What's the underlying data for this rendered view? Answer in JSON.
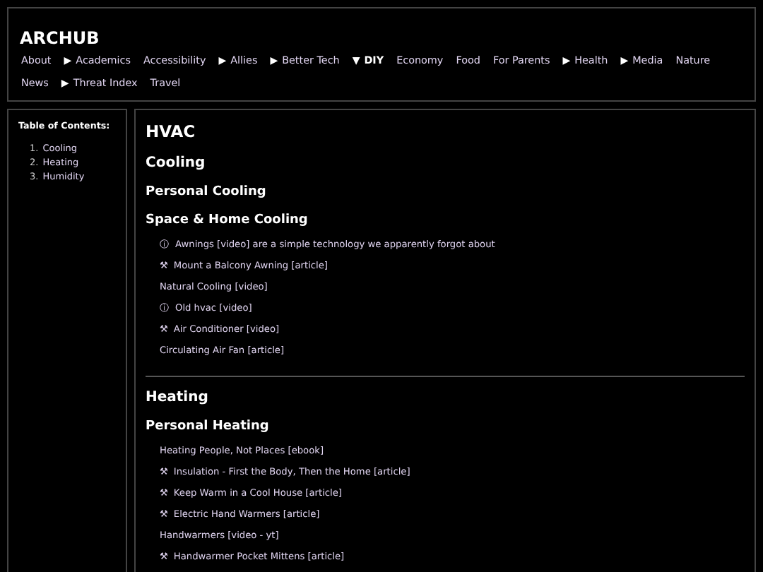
{
  "site": {
    "title": "ARCHUB"
  },
  "nav": [
    {
      "label": "About",
      "selected": false
    },
    {
      "label": "Academics",
      "marker": "▶",
      "selected": false
    },
    {
      "label": "Accessibility",
      "selected": false
    },
    {
      "label": "Allies",
      "marker": "▶",
      "selected": false
    },
    {
      "label": "Better Tech",
      "marker": "▶",
      "selected": false
    },
    {
      "label": "DIY",
      "marker": "▼",
      "selected": true
    },
    {
      "label": "Economy",
      "selected": false
    },
    {
      "label": "Food",
      "selected": false
    },
    {
      "label": "For Parents",
      "selected": false
    },
    {
      "label": "Health",
      "marker": "▶",
      "selected": false
    },
    {
      "label": "Media",
      "marker": "▶",
      "selected": false
    },
    {
      "label": "Nature",
      "selected": false
    },
    {
      "label": "News",
      "selected": false
    },
    {
      "label": "Threat Index",
      "marker": "▶",
      "selected": false
    },
    {
      "label": "Travel",
      "selected": false
    }
  ],
  "toc": {
    "title": "Table of Contents:",
    "items": [
      {
        "number": "1.",
        "label": "Cooling"
      },
      {
        "number": "2.",
        "label": "Heating"
      },
      {
        "number": "3.",
        "label": "Humidity"
      }
    ]
  },
  "content": {
    "title": "HVAC",
    "sections": [
      {
        "heading": "Cooling",
        "subsections": [
          {
            "heading": "Personal Cooling"
          },
          {
            "heading": "Space & Home Cooling",
            "links": [
              {
                "icon": "ⓘ",
                "text": "Awnings [video] are a simple technology we apparently forgot about"
              },
              {
                "icon": "⚒",
                "text": "Mount a Balcony Awning [article]"
              },
              {
                "text": "Natural Cooling [video]"
              },
              {
                "icon": "ⓘ",
                "text": "Old hvac [video]"
              },
              {
                "icon": "⚒",
                "text": "Air Conditioner [video]"
              },
              {
                "text": "Circulating Air Fan [article]"
              }
            ]
          }
        ]
      },
      {
        "heading": "Heating",
        "subsections": [
          {
            "heading": "Personal Heating",
            "links": [
              {
                "text": "Heating People, Not Places [ebook]"
              },
              {
                "icon": "⚒",
                "text": "Insulation - First the Body, Then the Home [article]"
              },
              {
                "icon": "⚒",
                "text": "Keep Warm in a Cool House [article]"
              },
              {
                "icon": "⚒",
                "text": "Electric Hand Warmers [article]"
              },
              {
                "text": "Handwarmers [video - yt]"
              },
              {
                "icon": "⚒",
                "text": "Handwarmer Pocket Mittens [article]"
              }
            ]
          }
        ]
      }
    ]
  }
}
